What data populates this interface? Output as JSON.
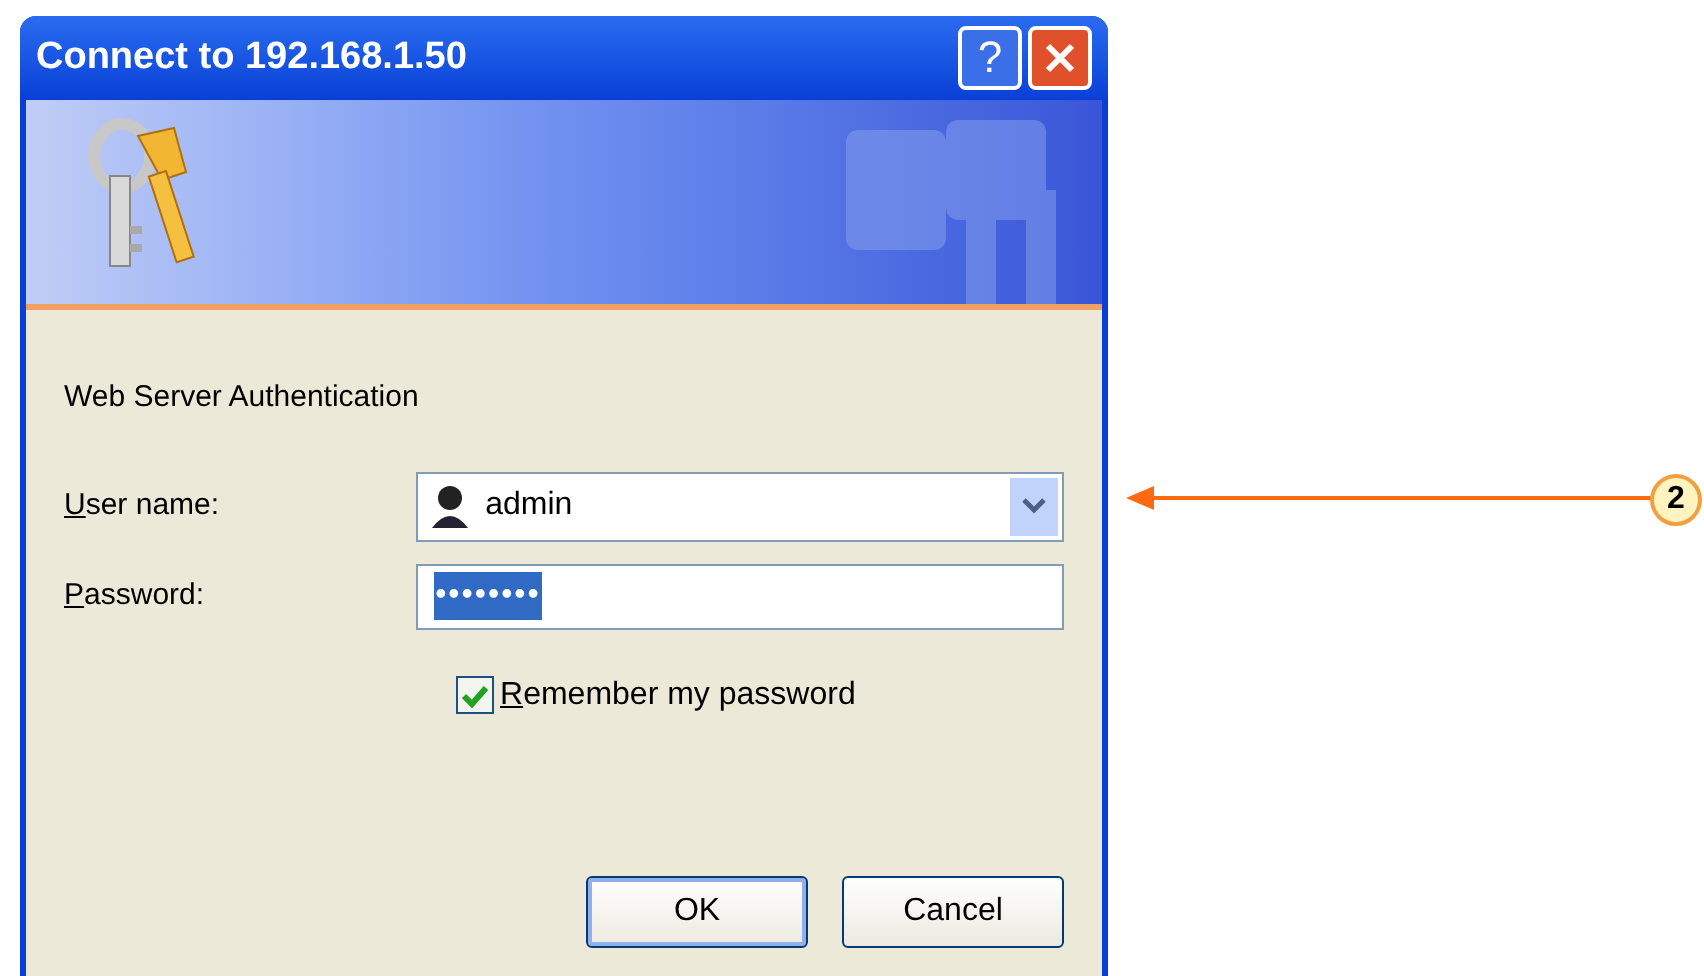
{
  "window": {
    "title": "Connect to 192.168.1.50",
    "title_buttons": [
      {
        "kind": "help",
        "label": "?"
      },
      {
        "kind": "close"
      }
    ]
  },
  "prompt": "Web Server Authentication",
  "fields": [
    {
      "label": "User name:",
      "underline_first": true,
      "kind": "combo",
      "value": "admin"
    },
    {
      "label": "Password:",
      "underline_first": true,
      "kind": "password",
      "value": "••••••••",
      "selected": true
    }
  ],
  "remember": {
    "label": "Remember my password",
    "underline_first": true,
    "checked": true
  },
  "buttons": [
    {
      "label": "OK",
      "default": true
    },
    {
      "label": "Cancel",
      "default": false
    }
  ],
  "callout": {
    "label": "2"
  }
}
